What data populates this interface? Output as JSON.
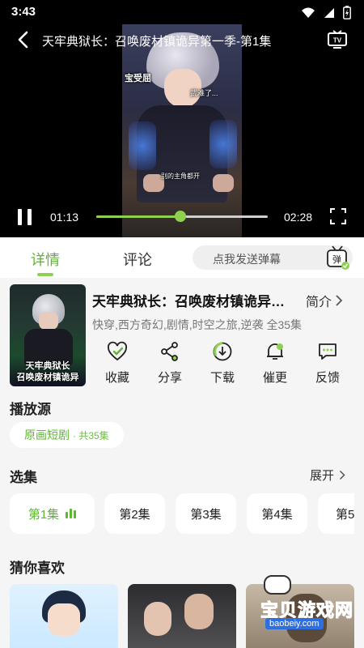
{
  "status_bar": {
    "time": "3:43"
  },
  "player": {
    "title": "天牢典狱长：召唤废材镇诡异第一季-第1集",
    "subtitles": [
      "宝受屈",
      "武难了...",
      "别的主角都开"
    ],
    "current_time": "01:13",
    "total_time": "02:28",
    "progress": 0.49
  },
  "tabs": [
    {
      "label": "详情",
      "active": true
    },
    {
      "label": "评论",
      "active": false
    }
  ],
  "danmu": {
    "placeholder": "点我发送弹幕",
    "icon_label": "弹"
  },
  "show": {
    "poster_line1": "天牢典狱长",
    "poster_line2": "召唤废材镇诡异",
    "title": "天牢典狱长：召唤废材镇诡异第一季",
    "intro_label": "简介",
    "tags": "快穿,西方奇幻,剧情,时空之旅,逆袭 全35集"
  },
  "actions": [
    {
      "label": "收藏",
      "icon": "heart-check-icon"
    },
    {
      "label": "分享",
      "icon": "share-icon"
    },
    {
      "label": "下载",
      "icon": "download-icon"
    },
    {
      "label": "催更",
      "icon": "notify-bell-icon"
    },
    {
      "label": "反馈",
      "icon": "feedback-icon"
    }
  ],
  "source": {
    "section_title": "播放源",
    "name": "原画短剧",
    "count": "· 共35集"
  },
  "episodes": {
    "section_title": "选集",
    "expand_label": "展开",
    "items": [
      {
        "label": "第1集",
        "active": true
      },
      {
        "label": "第2集",
        "active": false
      },
      {
        "label": "第3集",
        "active": false
      },
      {
        "label": "第4集",
        "active": false
      },
      {
        "label": "第5",
        "active": false
      }
    ]
  },
  "recommendations": {
    "section_title": "猜你喜欢"
  },
  "watermark": {
    "text": "宝贝游戏网",
    "url": "baobeiy.com"
  },
  "colors": {
    "accent": "#8fd14f",
    "accent_text": "#5cb82d",
    "background": "#f5f5f5"
  }
}
